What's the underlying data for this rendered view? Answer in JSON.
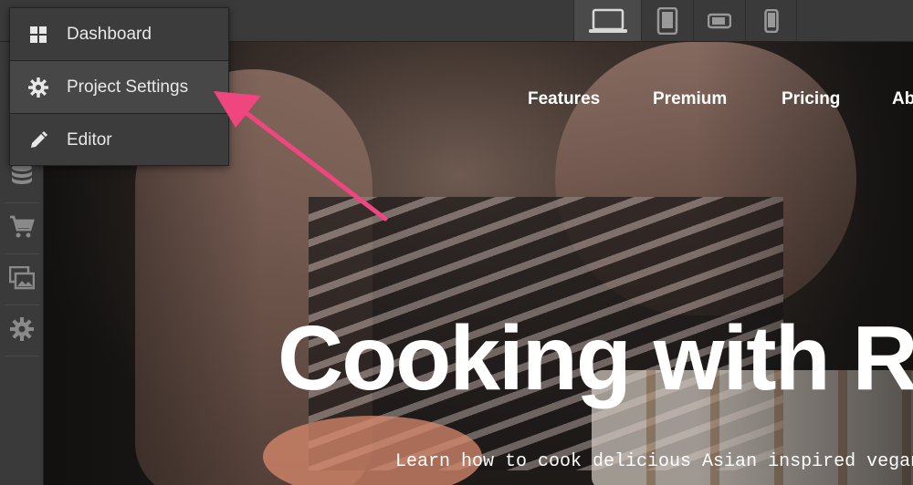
{
  "menu": {
    "items": [
      {
        "label": "Dashboard",
        "icon": "grid-icon"
      },
      {
        "label": "Project Settings",
        "icon": "gear-icon"
      },
      {
        "label": "Editor",
        "icon": "pencil-icon"
      }
    ]
  },
  "device_toolbar": {
    "devices": [
      "desktop-icon",
      "tablet-icon",
      "tablet-landscape-icon",
      "phone-icon"
    ],
    "active": "desktop-icon"
  },
  "sidebar": {
    "icons": [
      "database-icon",
      "cart-icon",
      "images-icon",
      "gear-icon"
    ]
  },
  "site": {
    "nav": [
      "Features",
      "Premium",
      "Pricing",
      "Ab"
    ],
    "hero_title": "Cooking with R",
    "hero_subtitle": "Learn how to cook delicious Asian inspired vegan"
  },
  "annotation": {
    "color": "#f0467f"
  }
}
